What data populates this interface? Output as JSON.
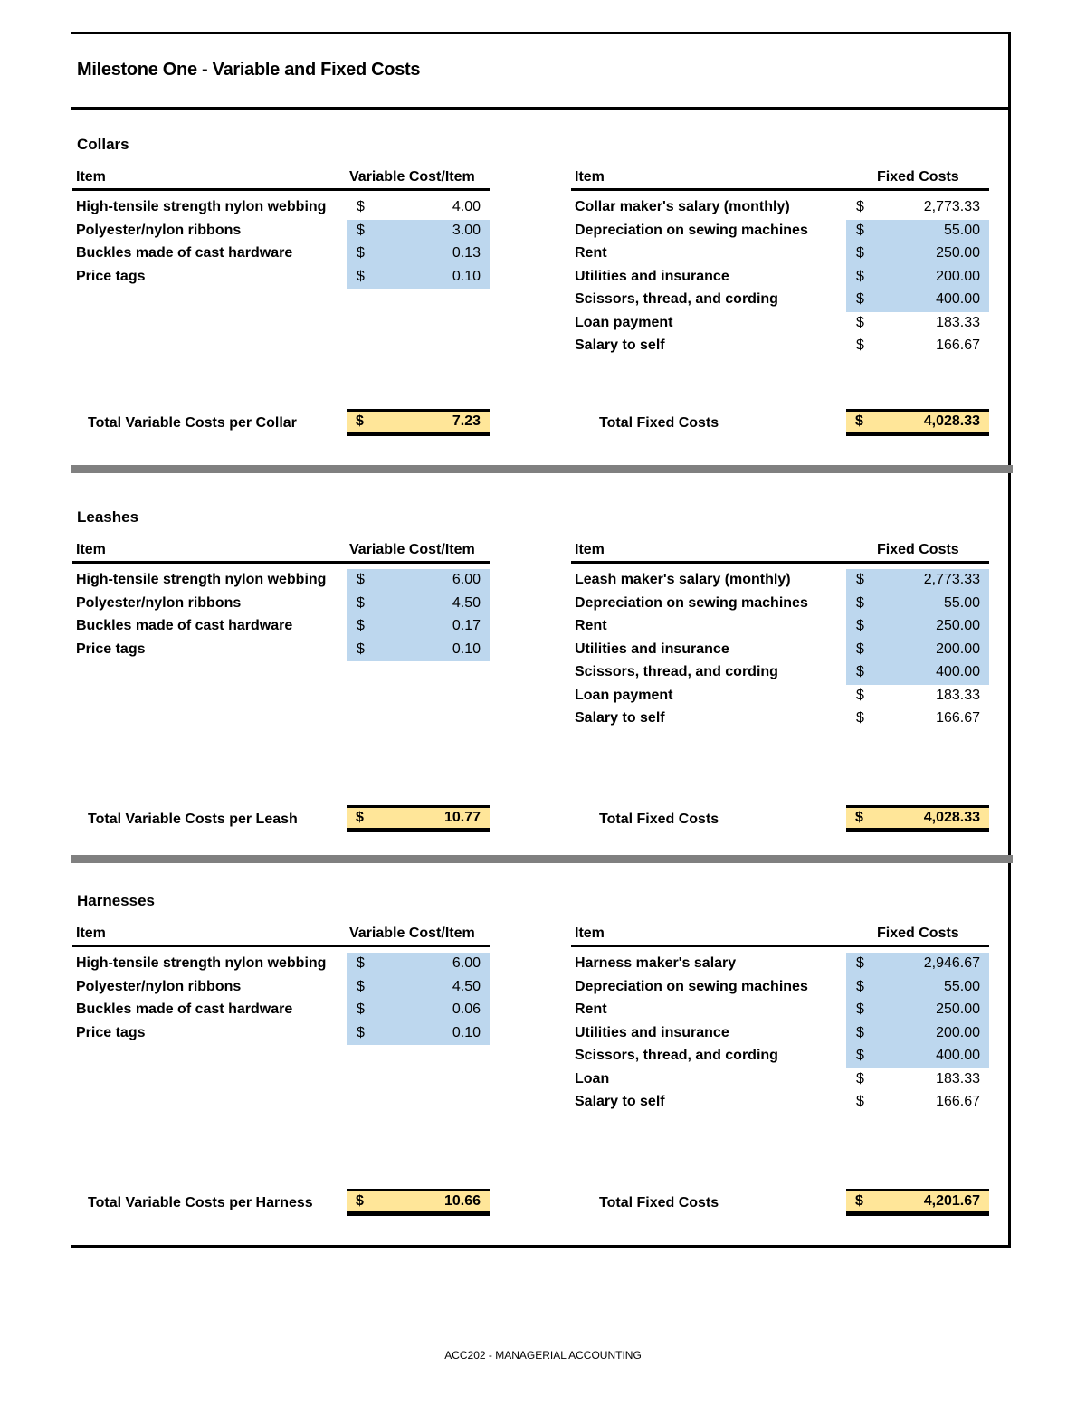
{
  "title": "Milestone One - Variable and Fixed Costs",
  "footer": "ACC202 - MANAGERIAL ACCOUNTING",
  "colors": {
    "highlight_blue": "#bdd7ee",
    "total_yellow": "#ffe699",
    "divider_gray": "#808080"
  },
  "currency_symbol": "$",
  "headers": {
    "item": "Item",
    "variable": "Variable Cost/Item",
    "fixed": "Fixed Costs"
  },
  "total_fixed_label": "Total Fixed Costs",
  "sections": [
    {
      "name": "Collars",
      "variable": [
        {
          "label": "High-tensile strength nylon webbing",
          "value": "4.00",
          "highlight": false
        },
        {
          "label": "Polyester/nylon ribbons",
          "value": "3.00",
          "highlight": true
        },
        {
          "label": "Buckles made of cast hardware",
          "value": "0.13",
          "highlight": true
        },
        {
          "label": "Price tags",
          "value": "0.10",
          "highlight": true
        }
      ],
      "fixed": [
        {
          "label": "Collar maker's salary (monthly)",
          "value": "2,773.33",
          "highlight": false
        },
        {
          "label": "Depreciation on sewing machines",
          "value": "55.00",
          "highlight": true
        },
        {
          "label": "Rent",
          "value": "250.00",
          "highlight": true
        },
        {
          "label": "Utilities and insurance",
          "value": "200.00",
          "highlight": true
        },
        {
          "label": "Scissors, thread, and cording",
          "value": "400.00",
          "highlight": true
        },
        {
          "label": "Loan payment",
          "value": "183.33",
          "highlight": false
        },
        {
          "label": "Salary to self",
          "value": "166.67",
          "highlight": false
        }
      ],
      "total_variable_label": "Total Variable Costs per Collar",
      "total_variable": "7.23",
      "total_fixed": "4,028.33"
    },
    {
      "name": "Leashes",
      "variable": [
        {
          "label": "High-tensile strength nylon webbing",
          "value": "6.00",
          "highlight": true
        },
        {
          "label": "Polyester/nylon ribbons",
          "value": "4.50",
          "highlight": true
        },
        {
          "label": "Buckles made of cast hardware",
          "value": "0.17",
          "highlight": true
        },
        {
          "label": "Price tags",
          "value": "0.10",
          "highlight": true
        }
      ],
      "fixed": [
        {
          "label": "Leash maker's salary (monthly)",
          "value": "2,773.33",
          "highlight": true
        },
        {
          "label": "Depreciation on sewing machines",
          "value": "55.00",
          "highlight": true
        },
        {
          "label": "Rent",
          "value": "250.00",
          "highlight": true
        },
        {
          "label": "Utilities and insurance",
          "value": "200.00",
          "highlight": true
        },
        {
          "label": "Scissors, thread, and cording",
          "value": "400.00",
          "highlight": true
        },
        {
          "label": "Loan payment",
          "value": "183.33",
          "highlight": false
        },
        {
          "label": "Salary to self",
          "value": "166.67",
          "highlight": false
        }
      ],
      "total_variable_label": "Total Variable Costs per Leash",
      "total_variable": "10.77",
      "total_fixed": "4,028.33"
    },
    {
      "name": "Harnesses",
      "variable": [
        {
          "label": "High-tensile strength nylon webbing",
          "value": "6.00",
          "highlight": true
        },
        {
          "label": "Polyester/nylon ribbons",
          "value": "4.50",
          "highlight": true
        },
        {
          "label": "Buckles made of cast hardware",
          "value": "0.06",
          "highlight": true
        },
        {
          "label": "Price tags",
          "value": "0.10",
          "highlight": true
        }
      ],
      "fixed": [
        {
          "label": "Harness maker's salary",
          "value": "2,946.67",
          "highlight": true
        },
        {
          "label": "Depreciation on sewing machines",
          "value": "55.00",
          "highlight": true
        },
        {
          "label": "Rent",
          "value": "250.00",
          "highlight": true
        },
        {
          "label": "Utilities and insurance",
          "value": "200.00",
          "highlight": true
        },
        {
          "label": "Scissors, thread, and cording",
          "value": "400.00",
          "highlight": true
        },
        {
          "label": "Loan",
          "value": "183.33",
          "highlight": false
        },
        {
          "label": "Salary to self",
          "value": "166.67",
          "highlight": false
        }
      ],
      "total_variable_label": "Total Variable Costs per Harness",
      "total_variable": "10.66",
      "total_fixed": "4,201.67"
    }
  ]
}
